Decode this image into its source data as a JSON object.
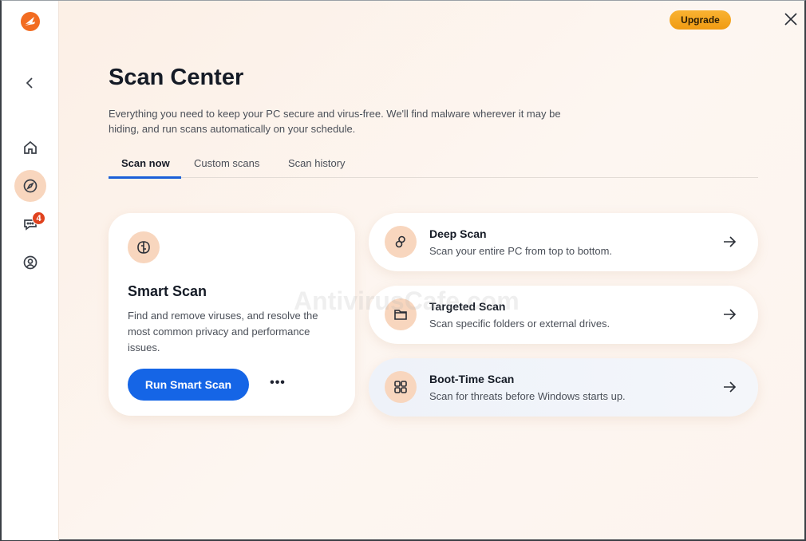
{
  "app": {
    "upgrade_label": "Upgrade",
    "watermark": "AntivirusCafe.com"
  },
  "sidebar": {
    "items": [
      {
        "name": "back",
        "icon": "chevron-left-icon"
      },
      {
        "name": "home",
        "icon": "home-icon"
      },
      {
        "name": "scan",
        "icon": "compass-icon",
        "active": true
      },
      {
        "name": "messages",
        "icon": "chat-icon",
        "badge": "4"
      },
      {
        "name": "account",
        "icon": "user-circle-icon"
      }
    ]
  },
  "header": {
    "title": "Scan Center",
    "description": "Everything you need to keep your PC secure and virus-free. We'll find malware wherever it may be hiding, and run scans automatically on your schedule."
  },
  "tabs": [
    {
      "label": "Scan now",
      "active": true
    },
    {
      "label": "Custom scans"
    },
    {
      "label": "Scan history"
    }
  ],
  "smart_scan": {
    "title": "Smart Scan",
    "description": "Find and remove viruses, and resolve the most common privacy and performance issues.",
    "button": "Run Smart Scan",
    "more": "•••"
  },
  "scans": [
    {
      "title": "Deep Scan",
      "subtitle": "Scan your entire PC from top to bottom."
    },
    {
      "title": "Targeted Scan",
      "subtitle": "Scan specific folders or external drives."
    },
    {
      "title": "Boot-Time Scan",
      "subtitle": "Scan for threats before Windows starts up."
    }
  ],
  "colors": {
    "accent": "#1565e6",
    "brand": "#f26c21",
    "upgrade": "#f5a623",
    "icon_bg": "#f8d6be"
  }
}
